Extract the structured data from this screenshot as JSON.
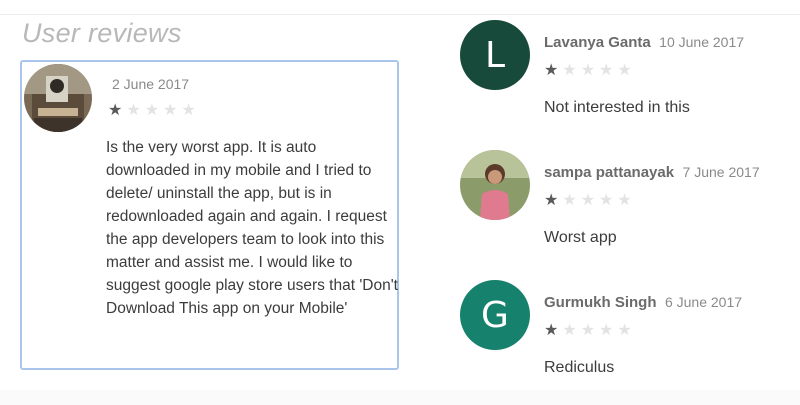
{
  "section": {
    "title": "User reviews"
  },
  "featured": {
    "date": "2 June 2017",
    "rating": 1,
    "body": "Is the very worst app. It is auto downloaded in my mobile and I tried to delete/ uninstall the app, but is in redownloaded again and again. I request the app developers team to look into this matter and assist me. I would like to suggest google play store users that 'Don't Download This app on your Mobile'"
  },
  "reviews": [
    {
      "avatar_letter": "L",
      "avatar_color": "#174a3b",
      "name": "Lavanya Ganta",
      "date": "10 June 2017",
      "rating": 1,
      "text": "Not interested in this"
    },
    {
      "avatar_letter": "",
      "avatar_color": "",
      "name": "sampa pattanayak",
      "date": "7 June 2017",
      "rating": 1,
      "text": "Worst app"
    },
    {
      "avatar_letter": "G",
      "avatar_color": "#16826d",
      "name": "Gurmukh Singh",
      "date": "6 June 2017",
      "rating": 1,
      "text": "Rediculus"
    }
  ],
  "star_max": 5,
  "colors": {
    "star_on": "#5a5a5a",
    "star_off": "#e3e3e3",
    "highlight_border": "#a9c5ec"
  }
}
